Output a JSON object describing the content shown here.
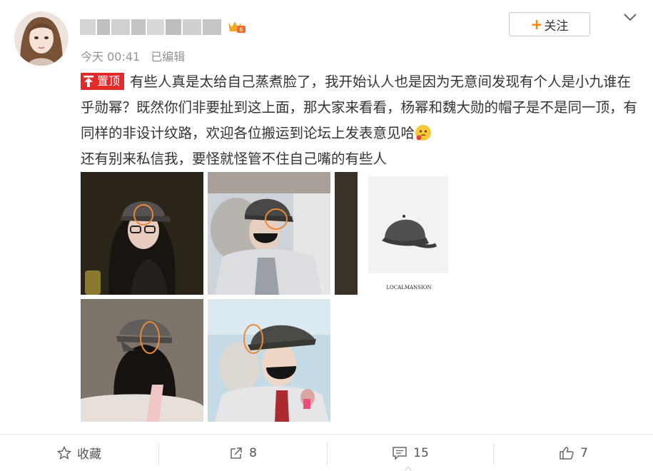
{
  "header": {
    "timestamp": "今天 00:41",
    "edited": "已编辑",
    "follow_label": "关注",
    "follow_plus": "+"
  },
  "post": {
    "pin_label": "置顶",
    "text_part1": "有些人真是太给自己蒸煮脸了，我开始认人也是因为无意间发现有个人是小九谁在乎勋幂？既然你们非要扯到这上面，那大家来看看，杨幂和魏大勋的帽子是不是同一顶，有同样的非设计纹路，欢迎各位搬运到论坛上发表意见哈",
    "text_part2": "还有别来私信我，要怪就怪管不住自己嘴的有些人"
  },
  "images": {
    "product_caption": "LOCALMANSION"
  },
  "actions": {
    "favorite_label": "收藏",
    "repost_count": "8",
    "comment_count": "15",
    "like_count": "7"
  },
  "colors": {
    "accent_orange": "#ff8200",
    "pin_red": "#e22a2a",
    "highlight_circle": "#e8893a"
  },
  "icons": {
    "favorite": "star-outline-icon",
    "repost": "repost-icon",
    "comment": "comment-icon",
    "like": "thumbs-up-icon",
    "menu": "chevron-down-icon"
  }
}
